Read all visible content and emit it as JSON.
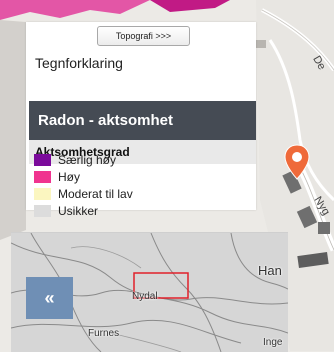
{
  "panel": {
    "topo_button_label": "Topografi >>>",
    "legend_heading": "Tegnforklaring",
    "layer_title": "Radon - aktsomhet",
    "layer_title_bg": "#454b54",
    "sub_header": "Aktsomhetsgrad",
    "items": [
      {
        "label": "Særlig høy",
        "color": "#7b0a9b"
      },
      {
        "label": "Høy",
        "color": "#f0348f"
      },
      {
        "label": "Moderat til lav",
        "color": "#fbf6c0"
      },
      {
        "label": "Usikker",
        "color": "#dcdcdc"
      }
    ]
  },
  "overview": {
    "labels": [
      "Han",
      "Nydal",
      "Furnes",
      "Inge"
    ],
    "extent_box_color": "#e0202a"
  },
  "map": {
    "street_labels": [
      "De",
      "Nyg"
    ],
    "marker_color": "#ef6a3a"
  },
  "collapse_button": {
    "label": "«",
    "color": "#6f8fb5"
  }
}
